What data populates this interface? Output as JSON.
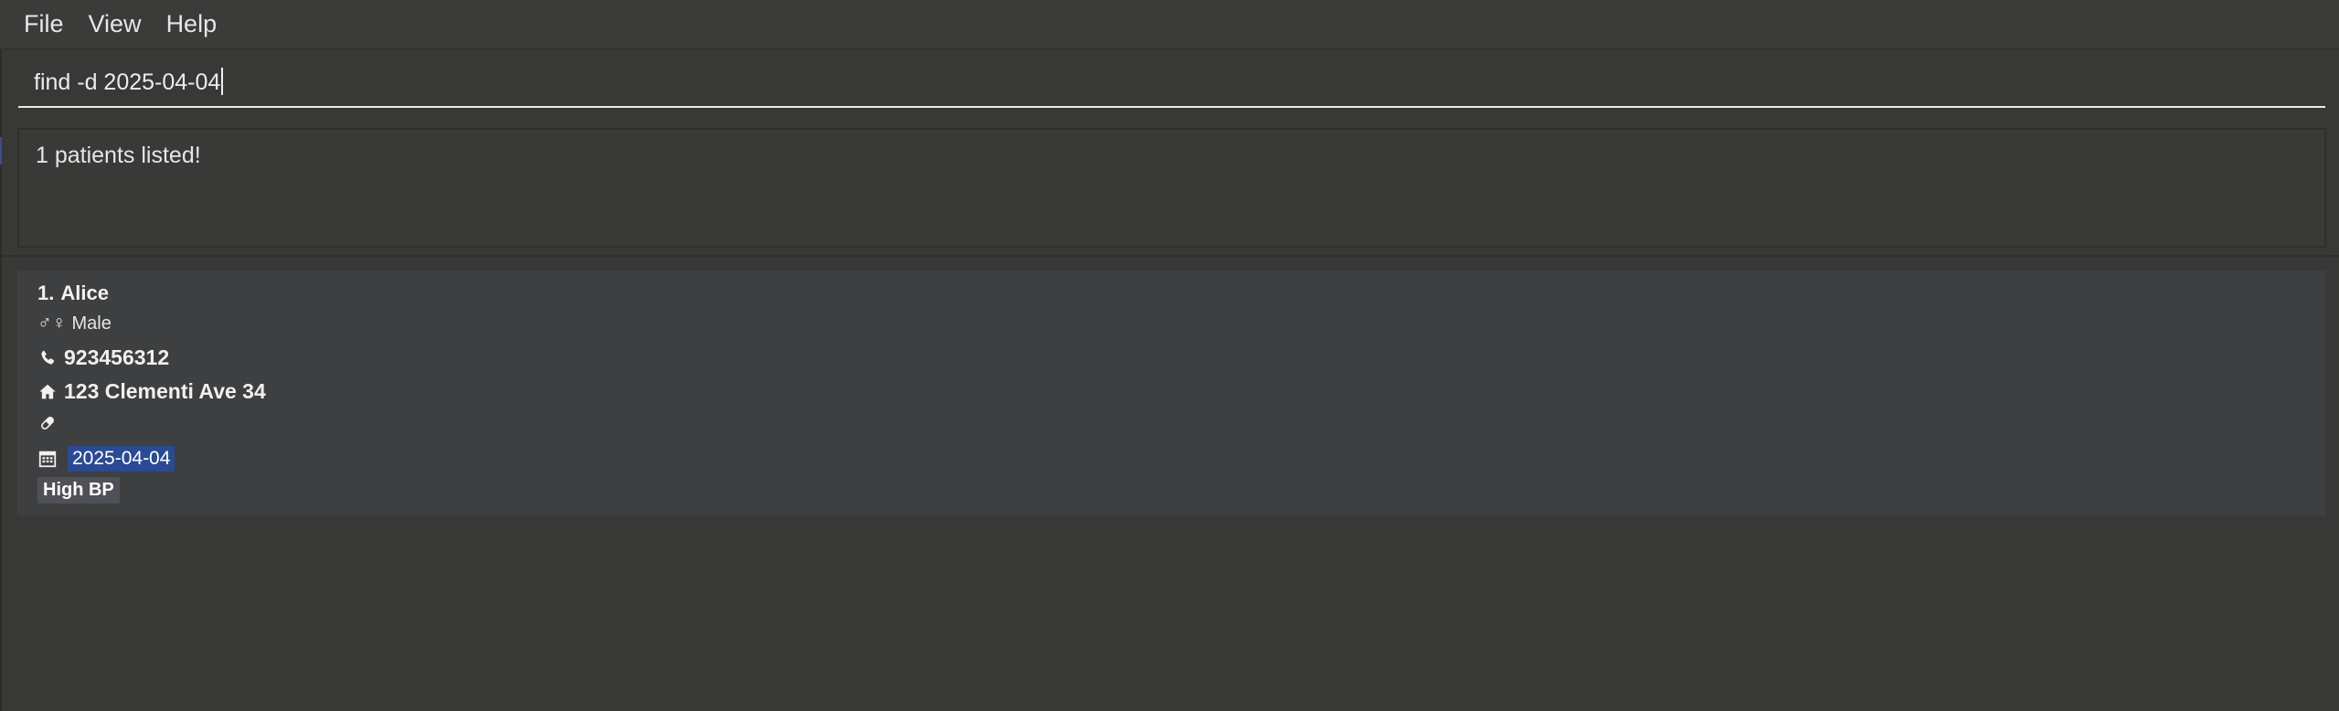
{
  "menu": {
    "file": "File",
    "view": "View",
    "help": "Help"
  },
  "command": {
    "value": "find -d 2025-04-04"
  },
  "result": {
    "message": "1 patients listed!"
  },
  "patients": [
    {
      "index": "1.",
      "name": "Alice",
      "gender_symbol": "♂♀",
      "gender": "Male",
      "phone": "923456312",
      "address": "123 Clementi Ave 34",
      "medicine": "",
      "appointment_date": "2025-04-04",
      "tags": [
        "High BP"
      ]
    }
  ],
  "colors": {
    "background": "#383836",
    "date_highlight": "#2a4a93",
    "tag_background": "#505058",
    "card_background": "#3e3f41"
  },
  "icons": {
    "gender": "gender-icon",
    "phone": "phone-icon",
    "address": "home-icon",
    "medicine": "pill-icon",
    "appointment": "calendar-icon"
  }
}
